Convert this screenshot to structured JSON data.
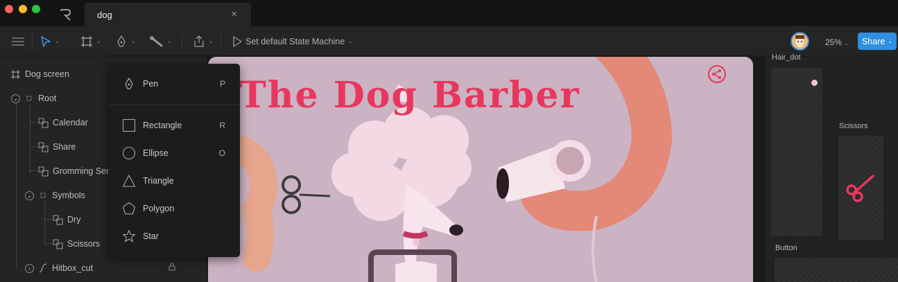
{
  "window": {
    "tab_title": "dog",
    "tab_close": "×"
  },
  "toolbar": {
    "state_machine_label": "Set default State Machine",
    "zoom": "25%",
    "share_label": "Share"
  },
  "hierarchy": {
    "items": [
      {
        "label": "Dog screen"
      },
      {
        "label": "Root"
      },
      {
        "label": "Calendar"
      },
      {
        "label": "Share"
      },
      {
        "label": "Gromming Serv"
      },
      {
        "label": "Symbols"
      },
      {
        "label": "Dry"
      },
      {
        "label": "Scissors"
      },
      {
        "label": "Hitbox_cut"
      }
    ]
  },
  "menu": {
    "items": [
      {
        "label": "Pen",
        "shortcut": "P",
        "icon": "pen-icon"
      },
      {
        "label": "Rectangle",
        "shortcut": "R",
        "icon": "rectangle-icon"
      },
      {
        "label": "Ellipse",
        "shortcut": "O",
        "icon": "ellipse-icon"
      },
      {
        "label": "Triangle",
        "shortcut": "",
        "icon": "triangle-icon"
      },
      {
        "label": "Polygon",
        "shortcut": "",
        "icon": "polygon-icon"
      },
      {
        "label": "Star",
        "shortcut": "",
        "icon": "star-icon"
      }
    ]
  },
  "canvas": {
    "headline": "The Dog Barber"
  },
  "right_panel": {
    "top_label": "Hair_dot",
    "scissors_label": "Scissors",
    "button_label": "Button"
  },
  "colors": {
    "accent_blue": "#2f8fe0",
    "artboard_bg": "#cbb3c3",
    "headline_pink": "#e8375f",
    "scissors_pink": "#e8375f"
  }
}
